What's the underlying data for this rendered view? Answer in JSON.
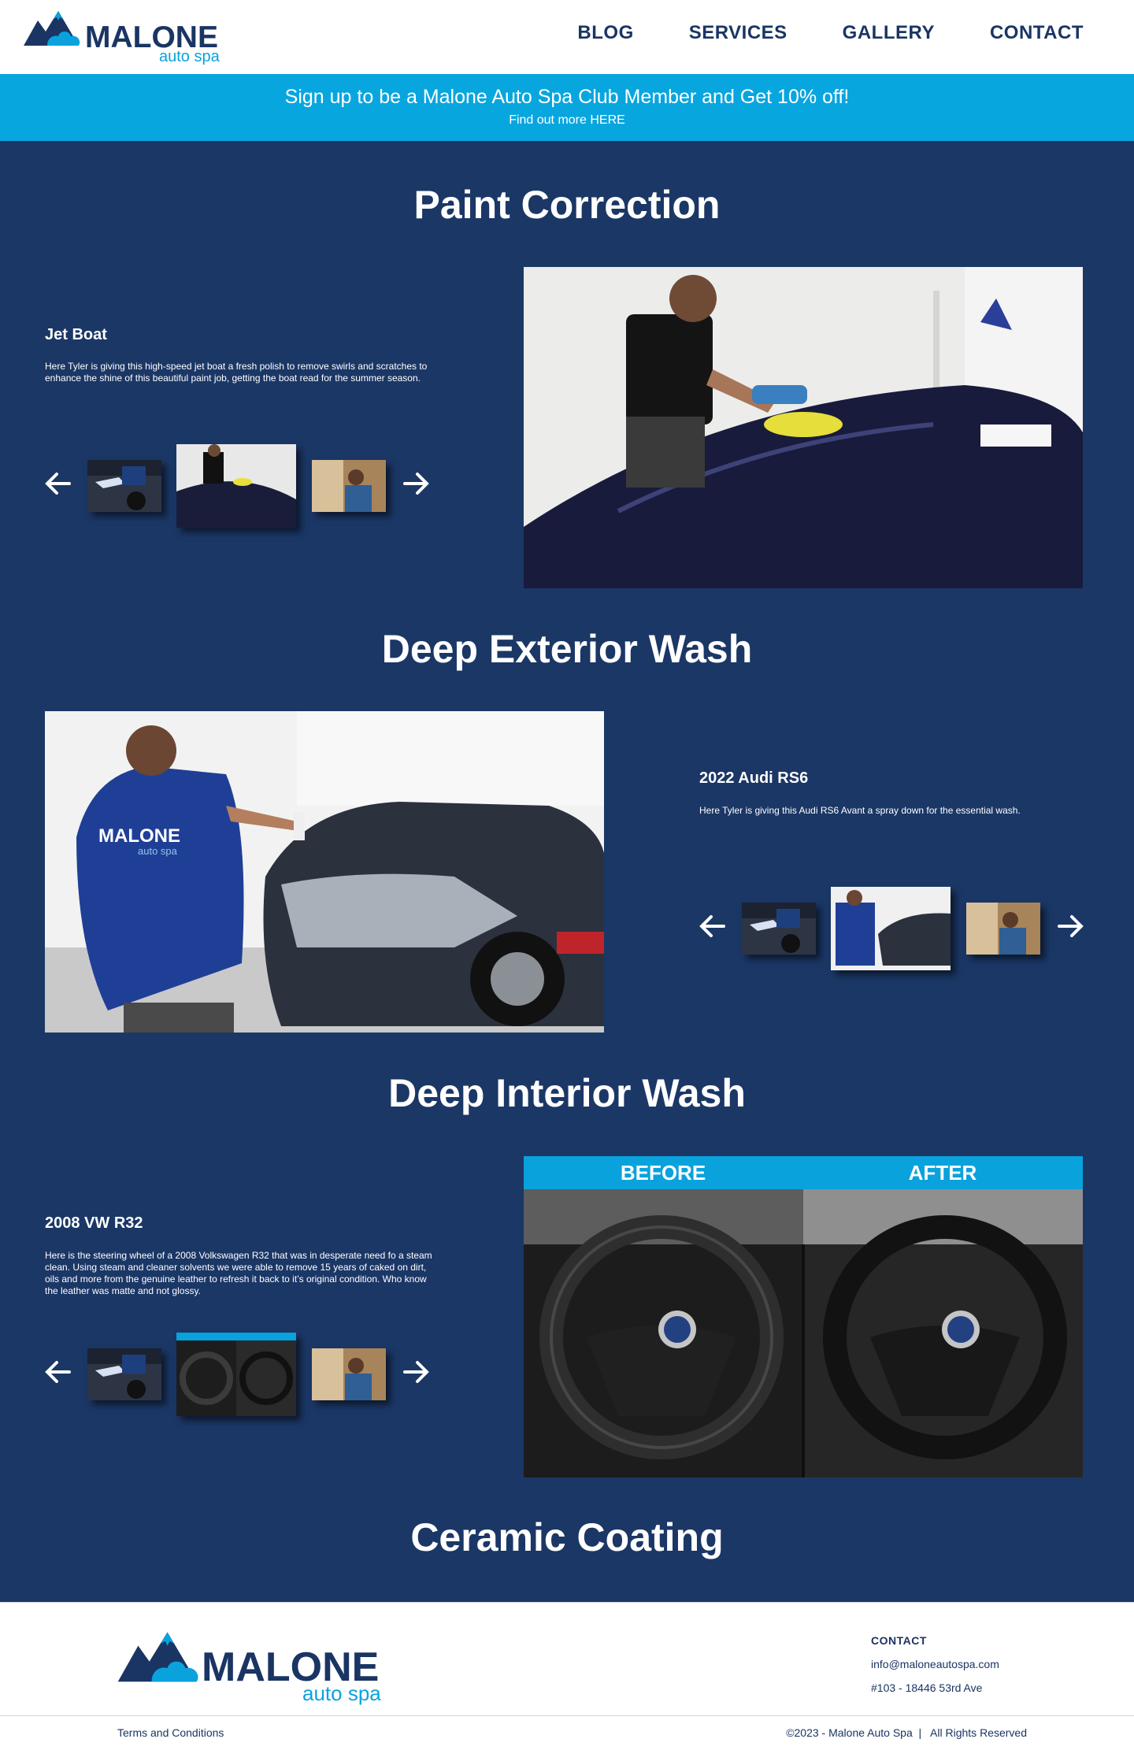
{
  "brand": {
    "name": "MALONE",
    "sub": "auto spa"
  },
  "nav": {
    "blog": "BLOG",
    "services": "SERVICES",
    "gallery": "GALLERY",
    "contact": "CONTACT"
  },
  "promo": {
    "title": "Sign up to be a Malone Auto Spa Club Member and Get 10% off!",
    "link": "Find out more HERE"
  },
  "sections": {
    "paint": {
      "title": "Paint Correction",
      "item_title": "Jet Boat",
      "item_desc": "Here Tyler is giving this high-speed jet boat a fresh polish to remove swirls and scratches to enhance the shine of this beautiful paint job, getting the boat read for the summer season."
    },
    "exterior": {
      "title": "Deep Exterior Wash",
      "item_title": "2022 Audi RS6",
      "item_desc": "Here Tyler is giving this Audi RS6 Avant a spray down for the essential wash.",
      "shirt_logo": "MALONE",
      "shirt_sub": "auto spa"
    },
    "interior": {
      "title": "Deep Interior Wash",
      "item_title": "2008 VW R32",
      "item_desc": "Here is the steering wheel of a 2008 Volkswagen R32 that was in desperate need fo a steam clean. Using steam and cleaner solvents we were able to remove 15 years of caked on dirt, oils and more from the genuine leather to refresh it back to it’s original condition. Who know the leather was matte and not glossy.",
      "before": "BEFORE",
      "after": "AFTER"
    },
    "ceramic": {
      "title": "Ceramic Coating"
    }
  },
  "footer": {
    "contact_heading": "CONTACT",
    "email": "info@maloneautospa.com",
    "address": "#103 - 18446 53rd Ave",
    "terms": "Terms and Conditions",
    "copyright": "©2023 - Malone Auto Spa  |   All Rights Reserved"
  },
  "colors": {
    "navy": "#1b3766",
    "accent": "#08a6df",
    "white": "#ffffff"
  }
}
